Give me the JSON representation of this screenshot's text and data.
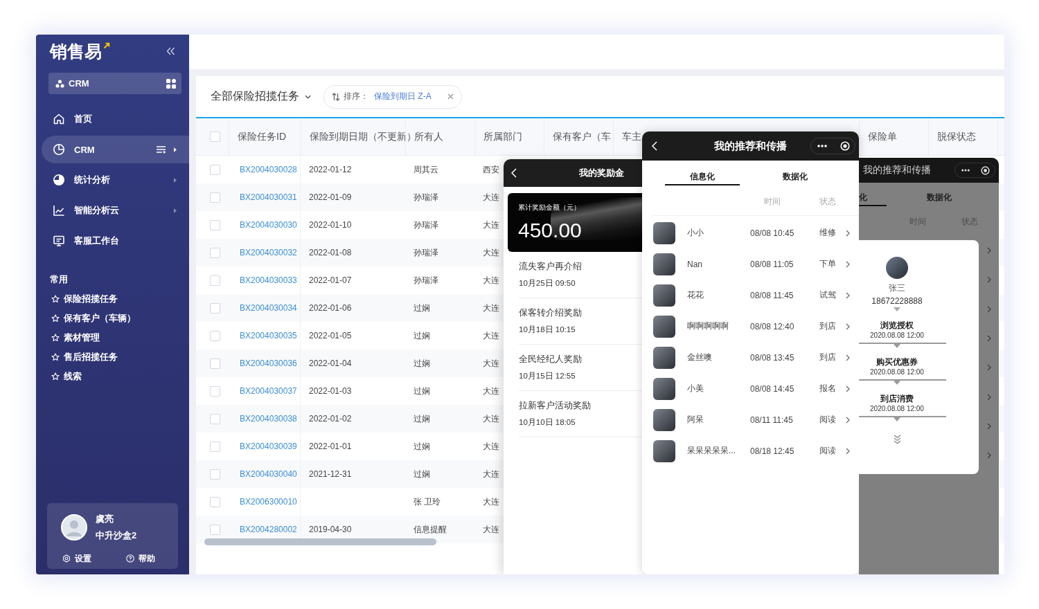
{
  "sidebar": {
    "logo": "销售易",
    "app_switcher": {
      "label": "CRM"
    },
    "nav": [
      {
        "kind": "home",
        "label": "首页",
        "selected": false,
        "has_submenu": false
      },
      {
        "kind": "pie-outline",
        "label": "CRM",
        "selected": true,
        "has_submenu": true
      },
      {
        "kind": "pie-filled",
        "label": "统计分析",
        "selected": false,
        "has_submenu": true
      },
      {
        "kind": "line-chart",
        "label": "智能分析云",
        "selected": false,
        "has_submenu": true
      },
      {
        "kind": "monitor",
        "label": "客服工作台",
        "selected": false,
        "has_submenu": false
      }
    ],
    "section_title": "常用",
    "favorites": [
      "保险招揽任务",
      "保有客户（车辆）",
      "素材管理",
      "售后招揽任务",
      "线索"
    ],
    "user": {
      "name": "虞亮",
      "org": "中升沙盒2",
      "actions": [
        {
          "kind": "settings",
          "label": "设置"
        },
        {
          "kind": "help",
          "label": "帮助"
        }
      ]
    }
  },
  "toolbar": {
    "view_title": "全部保险招揽任务",
    "sort": {
      "label": "排序：",
      "value": "保险到期日 Z-A"
    }
  },
  "table": {
    "all_checked": false,
    "columns": [
      "保险任务ID",
      "保险到期日期（不更新）",
      "所有人",
      "所属部门",
      "保有客户（车",
      "车主",
      "保险单",
      "脱保状态"
    ],
    "rows": [
      {
        "checked": false,
        "id": "BX2004030028",
        "date": "2022-01-12",
        "owner": "周其云",
        "department": "西安"
      },
      {
        "checked": false,
        "id": "BX2004030031",
        "date": "2022-01-09",
        "owner": "孙瑞泽",
        "department": "大连"
      },
      {
        "checked": false,
        "id": "BX2004030030",
        "date": "2022-01-10",
        "owner": "孙瑞泽",
        "department": "大连"
      },
      {
        "checked": false,
        "id": "BX2004030032",
        "date": "2022-01-08",
        "owner": "孙瑞泽",
        "department": "大连"
      },
      {
        "checked": false,
        "id": "BX2004030033",
        "date": "2022-01-07",
        "owner": "孙瑞泽",
        "department": "大连"
      },
      {
        "checked": false,
        "id": "BX2004030034",
        "date": "2022-01-06",
        "owner": "过娴",
        "department": "大连"
      },
      {
        "checked": false,
        "id": "BX2004030035",
        "date": "2022-01-05",
        "owner": "过娴",
        "department": "大连"
      },
      {
        "checked": false,
        "id": "BX2004030036",
        "date": "2022-01-04",
        "owner": "过娴",
        "department": "大连"
      },
      {
        "checked": false,
        "id": "BX2004030037",
        "date": "2022-01-03",
        "owner": "过娴",
        "department": "大连"
      },
      {
        "checked": false,
        "id": "BX2004030038",
        "date": "2022-01-02",
        "owner": "过娴",
        "department": "大连"
      },
      {
        "checked": false,
        "id": "BX2004030039",
        "date": "2022-01-01",
        "owner": "过娴",
        "department": "大连"
      },
      {
        "checked": false,
        "id": "BX2004030040",
        "date": "2021-12-31",
        "owner": "过娴",
        "department": "大连"
      },
      {
        "checked": false,
        "id": "BX2006300010",
        "owner": "张 卫玲",
        "department": "大连"
      },
      {
        "checked": false,
        "id": "BX2004280002",
        "date": "2019-04-30",
        "owner": "信息提醒",
        "department": "大连"
      }
    ]
  },
  "reward_panel": {
    "title": "我的奖励金",
    "total_label": "累计奖励金额（元）",
    "total": "450.00",
    "items": [
      {
        "title": "流失客户再介绍",
        "time": "10月25日 09:50"
      },
      {
        "title": "保客转介绍奖励",
        "time": "10月18日 10:15"
      },
      {
        "title": "全民经纪人奖励",
        "time": "10月15日 12:55"
      },
      {
        "title": "拉新客户活动奖励",
        "time": "10月10日 18:05"
      }
    ]
  },
  "recommend_panel": {
    "title": "我的推荐和传播",
    "tabs": [
      {
        "label": "信息化",
        "selected": true
      },
      {
        "label": "数据化",
        "selected": false
      }
    ],
    "columns": [
      "时间",
      "状态"
    ],
    "rows": [
      {
        "name": "小小",
        "time": "08/08 10:45",
        "status": "维修"
      },
      {
        "name": "Nan",
        "time": "08/08 11:05",
        "status": "下单"
      },
      {
        "name": "花花",
        "time": "08/08 11:45",
        "status": "试驾"
      },
      {
        "name": "啊啊啊啊啊",
        "time": "08/08 12:40",
        "status": "到店"
      },
      {
        "name": "金丝噢",
        "time": "08/08 13:45",
        "status": "到店"
      },
      {
        "name": "小美",
        "time": "08/08 14:45",
        "status": "报名"
      },
      {
        "name": "阿呆",
        "time": "08/11 11:45",
        "status": "阅读"
      },
      {
        "name": "呆呆呆呆呆...",
        "time": "08/18 12:45",
        "status": "阅读"
      }
    ]
  },
  "dimmed_panel": {
    "title": "我的推荐和传播",
    "tabs": [
      {
        "label": "化",
        "selected": true
      },
      {
        "label": "数据化",
        "selected": false
      }
    ],
    "columns": [
      "时间",
      "状态"
    ],
    "detail": {
      "name": "张三",
      "phone": "18672228888",
      "steps": [
        {
          "label": "浏览授权",
          "time": "2020.08.08 12:00"
        },
        {
          "label": "购买优惠券",
          "time": "2020.08.08 12:00"
        },
        {
          "label": "到店消费",
          "time": "2020.08.08 12:00"
        }
      ]
    }
  }
}
